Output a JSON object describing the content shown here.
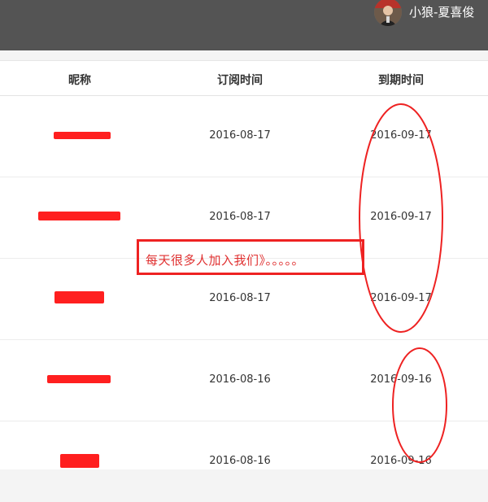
{
  "header": {
    "user_name": "小狼-夏喜俊"
  },
  "table": {
    "columns": [
      "昵称",
      "订阅时间",
      "到期时间"
    ],
    "rows": [
      {
        "subscribed": "2016-08-17",
        "expires": "2016-09-17"
      },
      {
        "subscribed": "2016-08-17",
        "expires": "2016-09-17"
      },
      {
        "subscribed": "2016-08-17",
        "expires": "2016-09-17"
      },
      {
        "subscribed": "2016-08-16",
        "expires": "2016-09-16"
      },
      {
        "subscribed": "2016-08-16",
        "expires": "2016-09-16"
      }
    ]
  },
  "annotation": {
    "note": "每天很多人加入我们》。。。。。",
    "color": "#ee2222"
  }
}
